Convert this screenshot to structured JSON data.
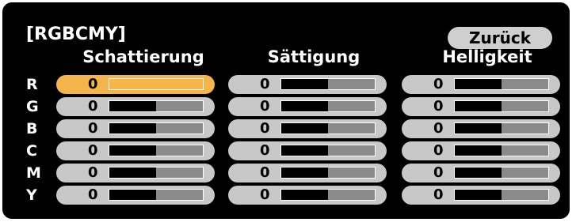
{
  "header": {
    "title": "[RGBCMY]",
    "back_label": "Zurück"
  },
  "columns": [
    {
      "key": "hue",
      "label": "Schattierung"
    },
    {
      "key": "saturation",
      "label": "Sättigung"
    },
    {
      "key": "brightness",
      "label": "Helligkeit"
    }
  ],
  "rows": [
    {
      "label": "R",
      "values": [
        "0",
        "0",
        "0"
      ]
    },
    {
      "label": "G",
      "values": [
        "0",
        "0",
        "0"
      ]
    },
    {
      "label": "B",
      "values": [
        "0",
        "0",
        "0"
      ]
    },
    {
      "label": "C",
      "values": [
        "0",
        "0",
        "0"
      ]
    },
    {
      "label": "M",
      "values": [
        "0",
        "0",
        "0"
      ]
    },
    {
      "label": "Y",
      "values": [
        "0",
        "0",
        "0"
      ]
    }
  ],
  "slider_level": 0.5,
  "selected": {
    "row": 0,
    "col": 0
  },
  "colors": {
    "panel": "#000000",
    "control": "#c8c8c8",
    "selected": "#f6b54b",
    "track": "#8a8a8a"
  }
}
